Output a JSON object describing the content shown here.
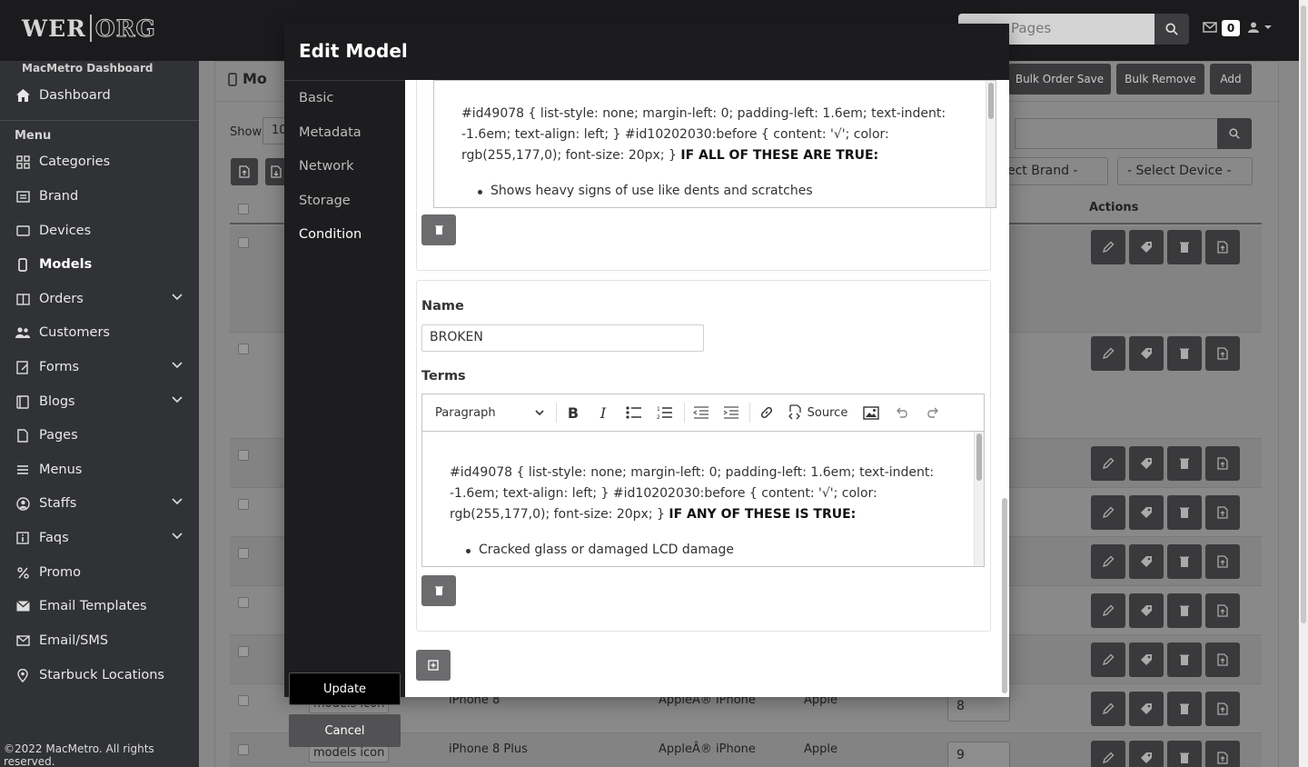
{
  "header": {
    "logo_left": "WER",
    "logo_right": "ORG",
    "search_placeholder": "Pages",
    "mail_count": "0"
  },
  "sidebar": {
    "dashboard_title": "MacMetro Dashboard",
    "dashboard": "Dashboard",
    "menu_label": "Menu",
    "items": [
      {
        "label": "Categories",
        "icon": "grid-icon"
      },
      {
        "label": "Brand",
        "icon": "list-icon"
      },
      {
        "label": "Devices",
        "icon": "tablet-icon"
      },
      {
        "label": "Models",
        "icon": "phone-icon"
      },
      {
        "label": "Orders",
        "icon": "columns-icon"
      },
      {
        "label": "Customers",
        "icon": "users-icon"
      },
      {
        "label": "Forms",
        "icon": "form-icon"
      },
      {
        "label": "Blogs",
        "icon": "book-icon"
      },
      {
        "label": "Pages",
        "icon": "file-icon"
      },
      {
        "label": "Menus",
        "icon": "menu-icon"
      },
      {
        "label": "Staffs",
        "icon": "user-circle-icon"
      },
      {
        "label": "Faqs",
        "icon": "info-icon"
      },
      {
        "label": "Promo",
        "icon": "percent-icon"
      },
      {
        "label": "Email Templates",
        "icon": "envelope-icon"
      },
      {
        "label": "Email/SMS",
        "icon": "mail-icon"
      },
      {
        "label": "Starbuck Locations",
        "icon": "map-pin-icon"
      }
    ],
    "copyright": "©2022 MacMetro. All rights reserved."
  },
  "page": {
    "title": "Mo",
    "bulk_order_save": "Bulk Order Save",
    "bulk_remove": "Bulk Remove",
    "add": "Add",
    "show_label": "Show",
    "show_value": "10",
    "select_brand": "ect Brand -",
    "select_device": "- Select Device -",
    "actions_header": "Actions",
    "rows": [
      {
        "img": "models icon",
        "name": "iPhone 8",
        "category": "AppleÂ® iPhone",
        "brand": "Apple",
        "order": "8"
      },
      {
        "img": "models icon",
        "name": "iPhone 8 Plus",
        "category": "AppleÂ® iPhone",
        "brand": "Apple",
        "order": "9"
      }
    ]
  },
  "modal": {
    "title": "Edit Model",
    "nav": [
      "Basic",
      "Metadata",
      "Network",
      "Storage",
      "Condition"
    ],
    "update": "Update",
    "cancel": "Cancel",
    "block1": {
      "css_text": "#id49078 { list-style: none; margin-left: 0; padding-left: 1.6em; text-indent: -1.6em; text-align: left; } #id10202030:before { content: '√'; color: rgb(255,177,0); font-size: 20px; }",
      "bold_text": "IF ALL OF THESE ARE TRUE:",
      "bullet": "Shows heavy signs of use like dents and scratches"
    },
    "block2": {
      "name_label": "Name",
      "name_value": "BROKEN",
      "terms_label": "Terms",
      "paragraph": "Paragraph",
      "source": "Source",
      "css_text": "#id49078 { list-style: none; margin-left: 0; padding-left: 1.6em; text-indent: -1.6em; text-align: left; } #id10202030:before { content: '√'; color: rgb(255,177,0); font-size: 20px; }",
      "bold_text": "IF ANY OF THESE IS TRUE:",
      "bullet": "Cracked glass or damaged LCD damage"
    }
  },
  "colors": {
    "topbar": "#1b1b1d",
    "sidebar": "#313235",
    "modal_header": "#1c1c1e",
    "button_dark": "#3a3a3c"
  }
}
